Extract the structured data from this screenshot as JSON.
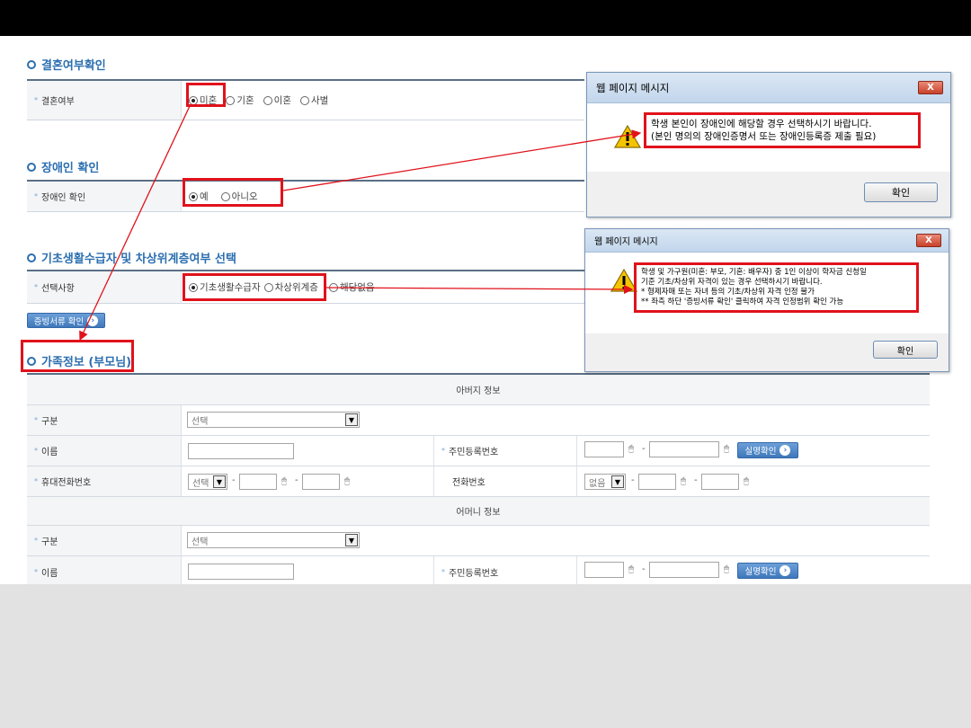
{
  "sections": {
    "marriage": {
      "title": "결혼여부확인",
      "label": "결혼여부",
      "options": [
        "미혼",
        "기혼",
        "이혼",
        "사별"
      ]
    },
    "disability": {
      "title": "장애인 확인",
      "label": "장애인 확인",
      "options": [
        "예",
        "아니오"
      ]
    },
    "welfare": {
      "title": "기초생활수급자 및 차상위계층여부 선택",
      "label": "선택사항",
      "options": [
        "기초생활수급자",
        "차상위계층",
        "해당없음"
      ],
      "proof_button": "증빙서류 확인"
    },
    "family": {
      "title": "가족정보 (부모님)"
    }
  },
  "dialog1": {
    "title": "웹 페이지 메시지",
    "close": "X",
    "message_line1": "학생 본인이 장애인에 해당할 경우 선택하시기 바랍니다.",
    "message_line2": "(본인 명의의 장애인증명서 또는 장애인등록증 제출 필요)",
    "ok": "확인"
  },
  "dialog2": {
    "title": "웹 페이지 메시지",
    "close": "X",
    "message_line1": "학생 및 가구원(미혼: 부모, 기혼: 배우자) 중 1인 이상이 학자금 신청일",
    "message_line2": "기준 기초/차상위 자격이 있는 경우 선택하시기 바랍니다.",
    "message_line3": "* 형제자매 또는 자녀 등의 기초/차상위 자격 인정 불가",
    "message_line4": "** 좌측 하단 '증빙서류 확인' 클릭하여 자격 인정범위 확인 가능",
    "ok": "확인"
  },
  "family_table": {
    "father_header": "아버지 정보",
    "mother_header": "어머니 정보",
    "gubun_label": "구분",
    "name_label": "이름",
    "rrn_label": "주민등록번호",
    "mobile_label": "휴대전화번호",
    "phone_label": "전화번호",
    "select_placeholder": "선택",
    "mobile_select": "선택",
    "phone_select": "없음",
    "verify_button": "실명확인",
    "dash": "-"
  },
  "colors": {
    "accent": "#2c6fb0",
    "highlight": "#e0121b"
  }
}
